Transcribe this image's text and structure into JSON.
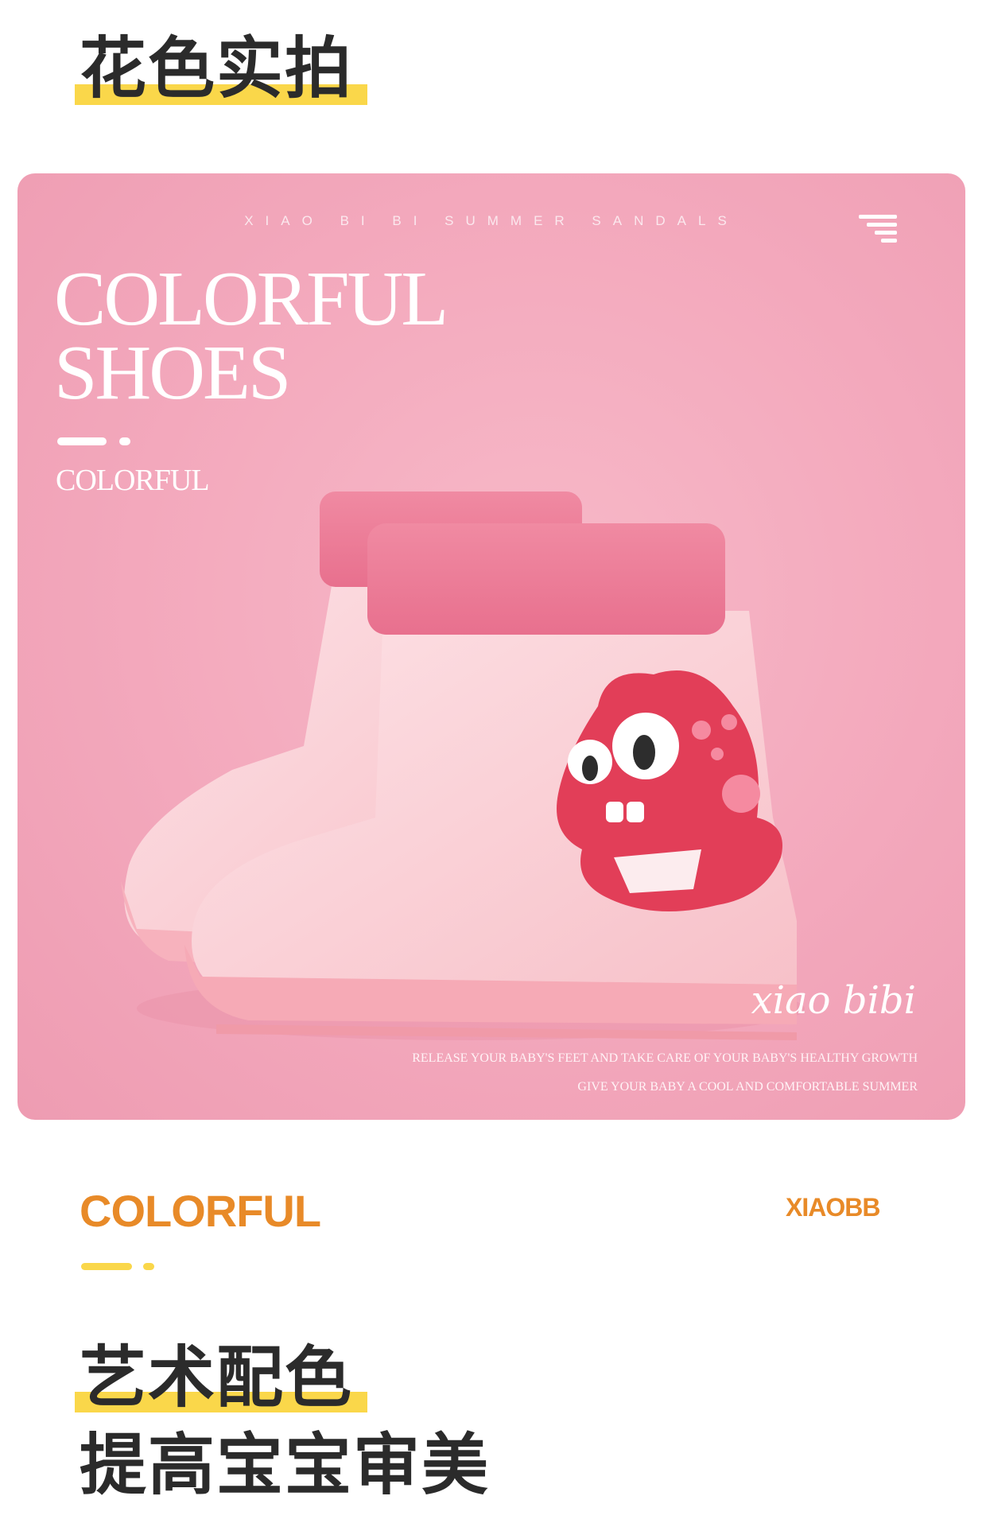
{
  "section1": {
    "heading": "花色实拍"
  },
  "hero": {
    "tagline": "XIAO BI BI SUMMER SANDALS",
    "title_line1": "COLORFUL",
    "title_line2": "SHOES",
    "subtitle": "COLORFUL",
    "script": "xiao bibi",
    "release_line1": "RELEASE YOUR BABY'S FEET AND TAKE CARE OF YOUR BABY'S HEALTHY GROWTH",
    "release_line2": "GIVE YOUR BABY A COOL AND COMFORTABLE SUMMER",
    "menu_icon": "menu-lines-icon"
  },
  "section2": {
    "label": "COLORFUL",
    "brand": "XIAOBB",
    "heading_line1": "艺术配色",
    "heading_line2": "提高宝宝审美"
  },
  "colors": {
    "highlight": "#fad74a",
    "accent_orange": "#e88a28",
    "hero_pink": "#f3a8bc",
    "heading_text": "#2b2b2b"
  }
}
